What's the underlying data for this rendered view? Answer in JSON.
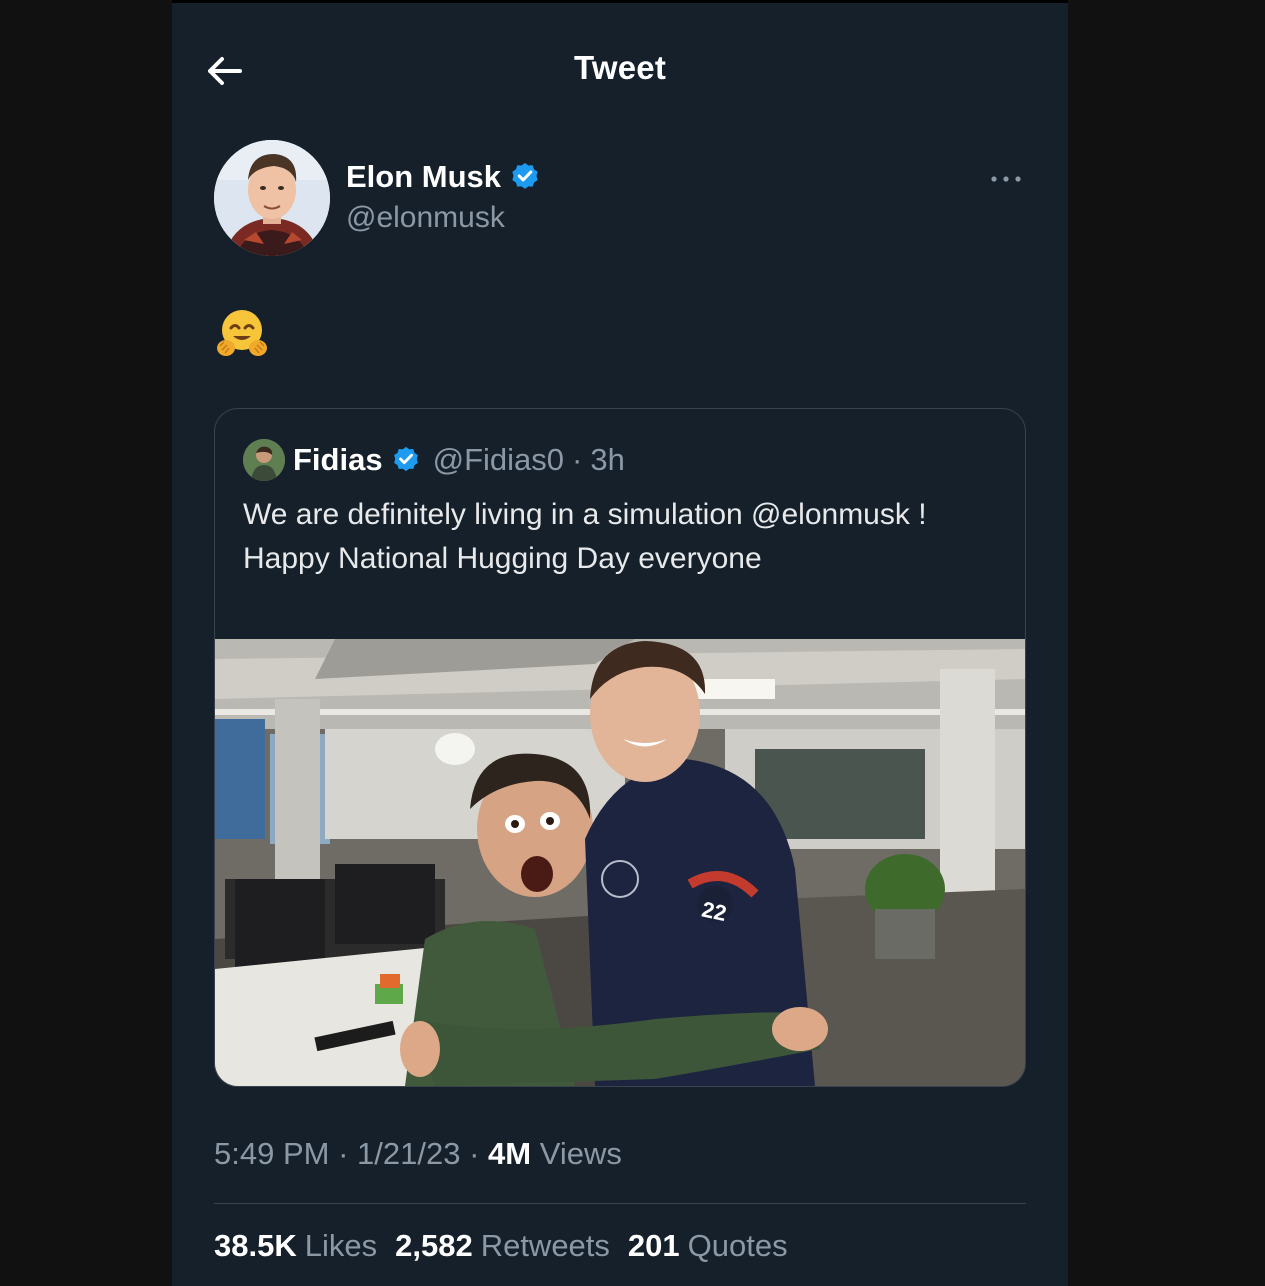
{
  "header": {
    "title": "Tweet"
  },
  "tweet": {
    "author_name": "Elon Musk",
    "author_handle": "@elonmusk",
    "text_emoji": "hugging-face-emoji",
    "quoted": {
      "name": "Fidias",
      "handle": "@Fidias0",
      "separator": "·",
      "time": "3h",
      "text": "We are definitely living in a simulation @elonmusk ! Happy National Hugging Day everyone"
    },
    "meta": {
      "time": "5:49 PM",
      "date": "1/21/23",
      "views_count": "4M",
      "views_label": "Views",
      "separator": "·"
    },
    "stats": {
      "likes_count": "38.5K",
      "likes_label": "Likes",
      "retweets_count": "2,582",
      "retweets_label": "Retweets",
      "quotes_count": "201",
      "quotes_label": "Quotes"
    }
  },
  "colors": {
    "background": "#15202b",
    "verified": "#1d9bf0",
    "secondary_text": "#8b98a5",
    "border": "#38444d"
  }
}
